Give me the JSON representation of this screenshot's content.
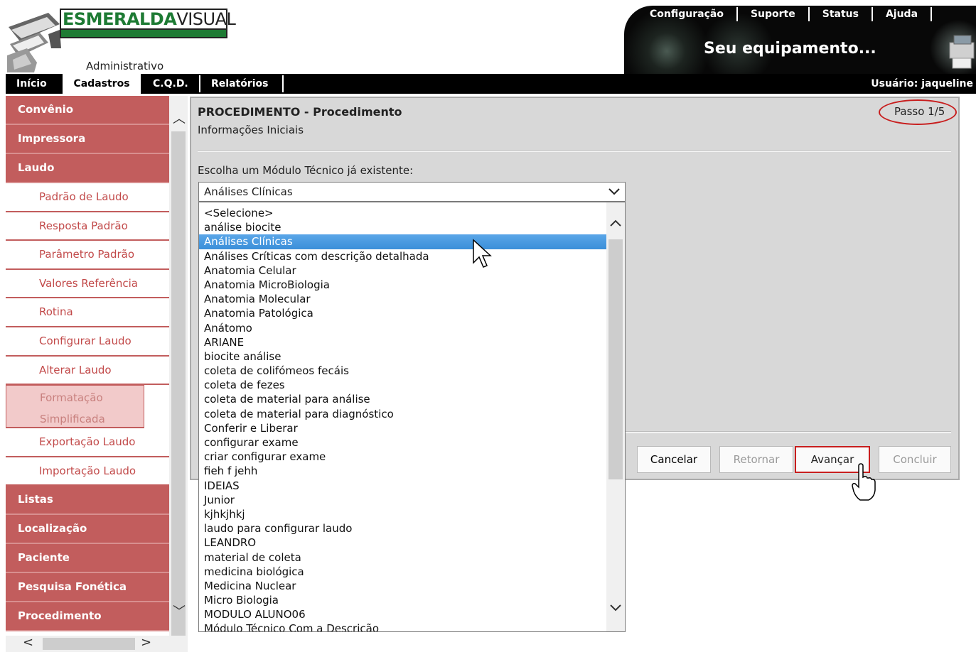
{
  "header": {
    "logo_main": "ESMERALDA",
    "logo_sub": "VISUAL",
    "section_label": "Administrativo",
    "banner_text": "Seu equipamento...",
    "top_links": [
      "Configuração",
      "Suporte",
      "Status",
      "Ajuda"
    ],
    "user_label": "Usuário: jaqueline"
  },
  "navbar": {
    "items": [
      "Início",
      "Cadastros",
      "C.Q.D.",
      "Relatórios"
    ],
    "active": "Cadastros"
  },
  "sidebar": {
    "top_sections": [
      "Convênio",
      "Impressora",
      "Laudo"
    ],
    "laudo_items": [
      "Padrão de Laudo",
      "Resposta Padrão",
      "Parâmetro Padrão",
      "Valores Referência",
      "Rotina",
      "Configurar Laudo",
      "Alterar Laudo",
      "Formatação Simplificada",
      "Exportação Laudo",
      "Importação Laudo"
    ],
    "selected_item": "Formatação Simplificada",
    "bottom_sections": [
      "Listas",
      "Localização",
      "Paciente",
      "Pesquisa Fonética",
      "Procedimento"
    ]
  },
  "panel": {
    "title": "PROCEDIMENTO - Procedimento",
    "subtitle": "Informações Iniciais",
    "step": "Passo 1/5",
    "choose_label": "Escolha um Módulo Técnico já existente:",
    "select_value": "Análises Clínicas",
    "options": [
      "<Selecione>",
      "análise biocite",
      "Análises Clínicas",
      "Análises Críticas com descrição detalhada",
      "Anatomia Celular",
      "Anatomia MicroBiologia",
      "Anatomia Molecular",
      "Anatomia Patológica",
      "Anátomo",
      "ARIANE",
      "biocite análise",
      "coleta de colifómeos fecáis",
      "coleta de fezes",
      "coleta de material para análise",
      "coleta de material para diagnóstico",
      "Conferir e Liberar",
      "configurar exame",
      "criar configurar exame",
      "fieh f jehh",
      "IDEIAS",
      "Junior",
      "kjhkjhkj",
      "laudo para configurar laudo",
      "LEANDRO",
      "material de coleta",
      "medicina biológica",
      "Medicina Nuclear",
      "Micro Biologia",
      "MODULO ALUNO06",
      "Módulo Técnico Com a Descrição"
    ],
    "highlighted_option": "Análises Clínicas",
    "buttons": {
      "cancel": "Cancelar",
      "back": "Retornar",
      "next": "Avançar",
      "finish": "Concluir"
    }
  },
  "colors": {
    "sidebar_section": "#c25d5d",
    "sidebar_sub_text": "#c24a4a",
    "highlight": "#3b8fd9",
    "annotation_red": "#c81e1e",
    "logo_green": "#1e7b34"
  }
}
